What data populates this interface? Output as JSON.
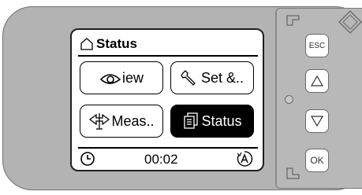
{
  "header": {
    "title": "Status",
    "icon": "home-icon"
  },
  "tiles": [
    {
      "label": "iew",
      "icon": "eye-icon",
      "active": false
    },
    {
      "label": "Set &..",
      "icon": "wrench-icon",
      "active": false
    },
    {
      "label": "Meas..",
      "icon": "measure-icon",
      "active": false
    },
    {
      "label": "Status",
      "icon": "status-icon",
      "active": true
    }
  ],
  "footer": {
    "time": "00:02",
    "left_icon": "clock-icon",
    "right_icon": "auto-mode-icon"
  },
  "buttons": {
    "esc_label": "ESC",
    "up_icon": "up-triangle-icon",
    "down_icon": "down-triangle-icon",
    "ok_label": "OK"
  },
  "colors": {
    "housing": "#b3b3b3",
    "screen_bg": "#ffffff",
    "active_tile": "#000000"
  }
}
